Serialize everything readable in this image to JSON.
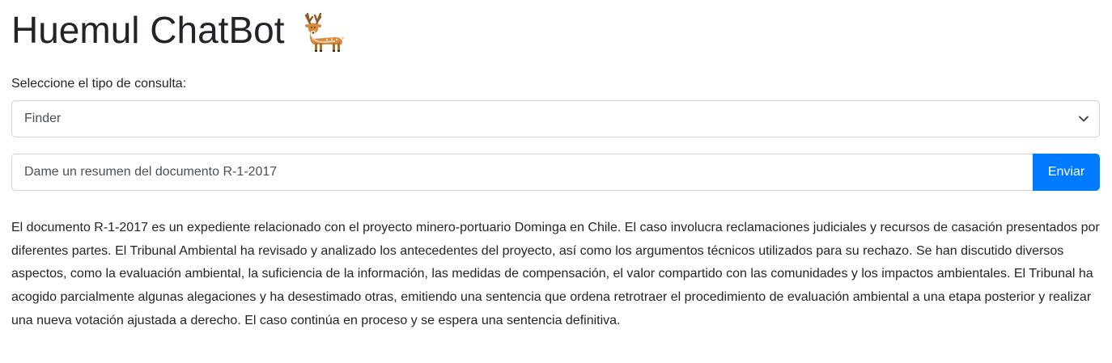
{
  "header": {
    "title": "Huemul ChatBot",
    "icon": "deer-icon"
  },
  "query_type": {
    "label": "Seleccione el tipo de consulta:",
    "selected": "Finder"
  },
  "chat_input": {
    "value": "Dame un resumen del documento R-1-2017",
    "send_label": "Enviar"
  },
  "response": {
    "text": "El documento R-1-2017 es un expediente relacionado con el proyecto minero-portuario Dominga en Chile. El caso involucra reclamaciones judiciales y recursos de casación presentados por diferentes partes. El Tribunal Ambiental ha revisado y analizado los antecedentes del proyecto, así como los argumentos técnicos utilizados para su rechazo. Se han discutido diversos aspectos, como la evaluación ambiental, la suficiencia de la información, las medidas de compensación, el valor compartido con las comunidades y los impactos ambientales. El Tribunal ha acogido parcialmente algunas alegaciones y ha desestimado otras, emitiendo una sentencia que ordena retrotraer el procedimiento de evaluación ambiental a una etapa posterior y realizar una nueva votación ajustada a derecho. El caso continúa en proceso y se espera una sentencia definitiva."
  },
  "colors": {
    "primary": "#007bff",
    "text": "#212529",
    "border": "#ced4da"
  }
}
